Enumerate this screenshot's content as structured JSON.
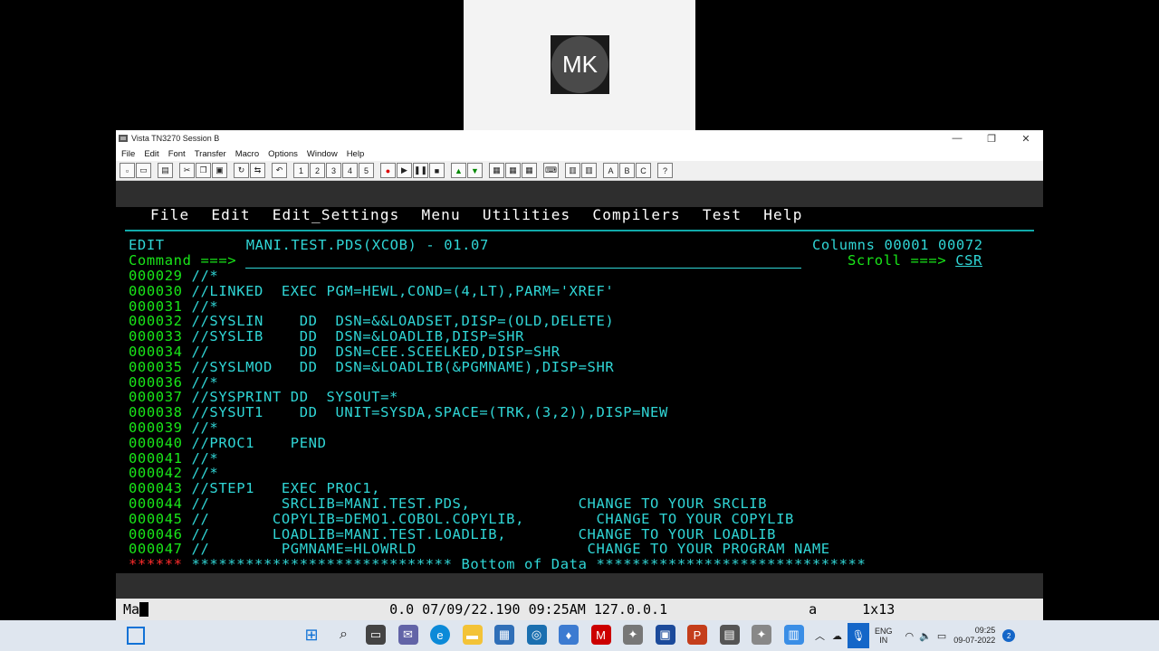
{
  "meeting": {
    "avatar_initials": "MK"
  },
  "window": {
    "title": "Vista TN3270 Session B",
    "menu": [
      "File",
      "Edit",
      "Font",
      "Transfer",
      "Macro",
      "Options",
      "Window",
      "Help"
    ],
    "toolbar_letters": [
      "A",
      "B",
      "C",
      "?"
    ]
  },
  "ispf": {
    "actionbar": [
      "File",
      "Edit",
      "Edit_Settings",
      "Menu",
      "Utilities",
      "Compilers",
      "Test",
      "Help"
    ],
    "mode": "EDIT",
    "dataset": "MANI.TEST.PDS(XCOB) - 01.07",
    "columns": "Columns 00001 00072",
    "command_label": "Command ===>",
    "scroll_label": "Scroll ===>",
    "scroll_value": "CSR",
    "lines": [
      {
        "num": "000029",
        "text": "//*"
      },
      {
        "num": "000030",
        "text": "//LINKED  EXEC PGM=HEWL,COND=(4,LT),PARM='XREF'"
      },
      {
        "num": "000031",
        "text": "//*"
      },
      {
        "num": "000032",
        "text": "//SYSLIN    DD  DSN=&&LOADSET,DISP=(OLD,DELETE)"
      },
      {
        "num": "000033",
        "text": "//SYSLIB    DD  DSN=&LOADLIB,DISP=SHR"
      },
      {
        "num": "000034",
        "text": "//          DD  DSN=CEE.SCEELKED,DISP=SHR"
      },
      {
        "num": "000035",
        "text": "//SYSLMOD   DD  DSN=&LOADLIB(&PGMNAME),DISP=SHR"
      },
      {
        "num": "000036",
        "text": "//*"
      },
      {
        "num": "000037",
        "text": "//SYSPRINT DD  SYSOUT=*"
      },
      {
        "num": "000038",
        "text": "//SYSUT1    DD  UNIT=SYSDA,SPACE=(TRK,(3,2)),DISP=NEW"
      },
      {
        "num": "000039",
        "text": "//*"
      },
      {
        "num": "000040",
        "text": "//PROC1    PEND"
      },
      {
        "num": "000041",
        "text": "//*"
      },
      {
        "num": "000042",
        "text": "//*"
      },
      {
        "num": "000043",
        "text": "//STEP1   EXEC PROC1,"
      },
      {
        "num": "000044",
        "text": "//        SRCLIB=MANI.TEST.PDS,            CHANGE TO YOUR SRCLIB"
      },
      {
        "num": "000045",
        "text": "//       COPYLIB=DEMO1.COBOL.COPYLIB,        CHANGE TO YOUR COPYLIB"
      },
      {
        "num": "000046",
        "text": "//       LOADLIB=MANI.TEST.LOADLIB,        CHANGE TO YOUR LOADLIB"
      },
      {
        "num": "000047",
        "text": "//        PGMNAME=HLOWRLD                   CHANGE TO YOUR PROGRAM NAME"
      }
    ],
    "bottom_marker": "******",
    "bottom_text": " ***************************** Bottom of Data ******************************"
  },
  "statusbar": {
    "input": "Ma",
    "info": "0.0 07/09/22.190 09:25AM 127.0.0.1",
    "mode": "a",
    "position": "1x13"
  },
  "taskbar": {
    "lang_top": "ENG",
    "lang_bottom": "IN",
    "time": "09:25",
    "date": "09-07-2022",
    "notifications": "2"
  }
}
